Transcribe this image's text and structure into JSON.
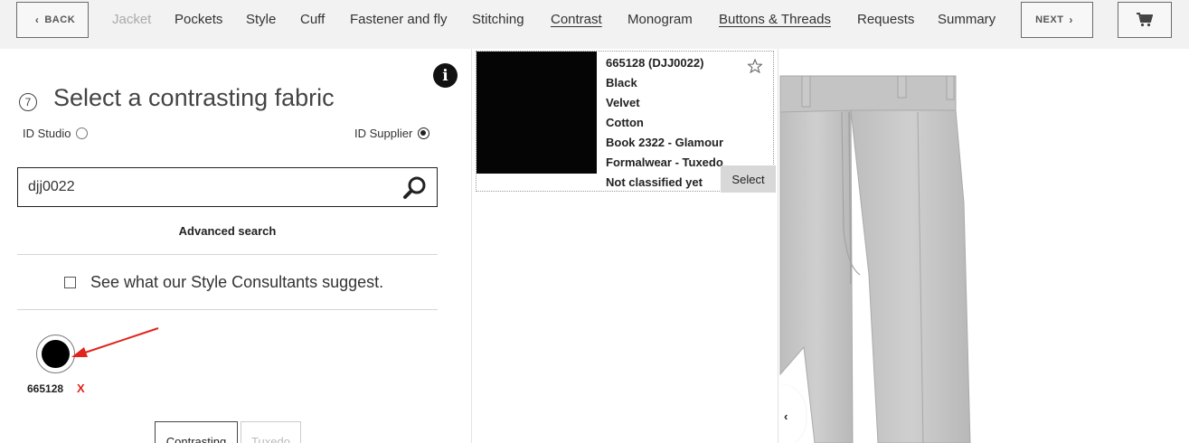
{
  "nav": {
    "back_label": "BACK",
    "next_label": "NEXT",
    "items": [
      {
        "label": "Jacket",
        "state": "disabled"
      },
      {
        "label": "Pockets",
        "state": "normal"
      },
      {
        "label": "Style",
        "state": "normal"
      },
      {
        "label": "Cuff",
        "state": "normal"
      },
      {
        "label": "Fastener and fly",
        "state": "normal"
      },
      {
        "label": "Stitching",
        "state": "normal"
      },
      {
        "label": "Contrast",
        "state": "active"
      },
      {
        "label": "Monogram",
        "state": "normal"
      },
      {
        "label": "Buttons & Threads",
        "state": "active"
      },
      {
        "label": "Requests",
        "state": "normal"
      },
      {
        "label": "Summary",
        "state": "normal"
      }
    ],
    "cart_icon": "cart-icon"
  },
  "panel": {
    "step_number": "7",
    "title": "Select a contrasting fabric",
    "info_icon": "info-icon",
    "source_options": {
      "studio_label": "ID Studio",
      "supplier_label": "ID Supplier",
      "selected": "ID Supplier"
    },
    "search": {
      "value": "djj0022",
      "placeholder": ""
    },
    "advanced_search_label": "Advanced search",
    "consultants_label": "See what our Style Consultants suggest.",
    "consultants_checked": false,
    "selected_swatch": {
      "code": "665128",
      "remove_label": "X",
      "color": "#000000"
    },
    "tabs": [
      {
        "label": "Contrasting",
        "active": true
      },
      {
        "label": "Tuxedo",
        "active": false
      }
    ]
  },
  "results": [
    {
      "lines": [
        "665128 (DJJ0022)",
        "Black",
        "Velvet",
        "Cotton",
        "Book 2322 - Glamour",
        "Formalwear - Tuxedo",
        "Not classified yet"
      ],
      "select_label": "Select",
      "favorite_icon": "star-icon",
      "swatch_color": "#050505"
    }
  ],
  "preview": {
    "trouser_color": "#c9c9c9",
    "collapse_icon": "chevron-left-icon"
  },
  "colors": {
    "accent_red": "#e0231c",
    "nav_bg": "#f2f2f2"
  }
}
